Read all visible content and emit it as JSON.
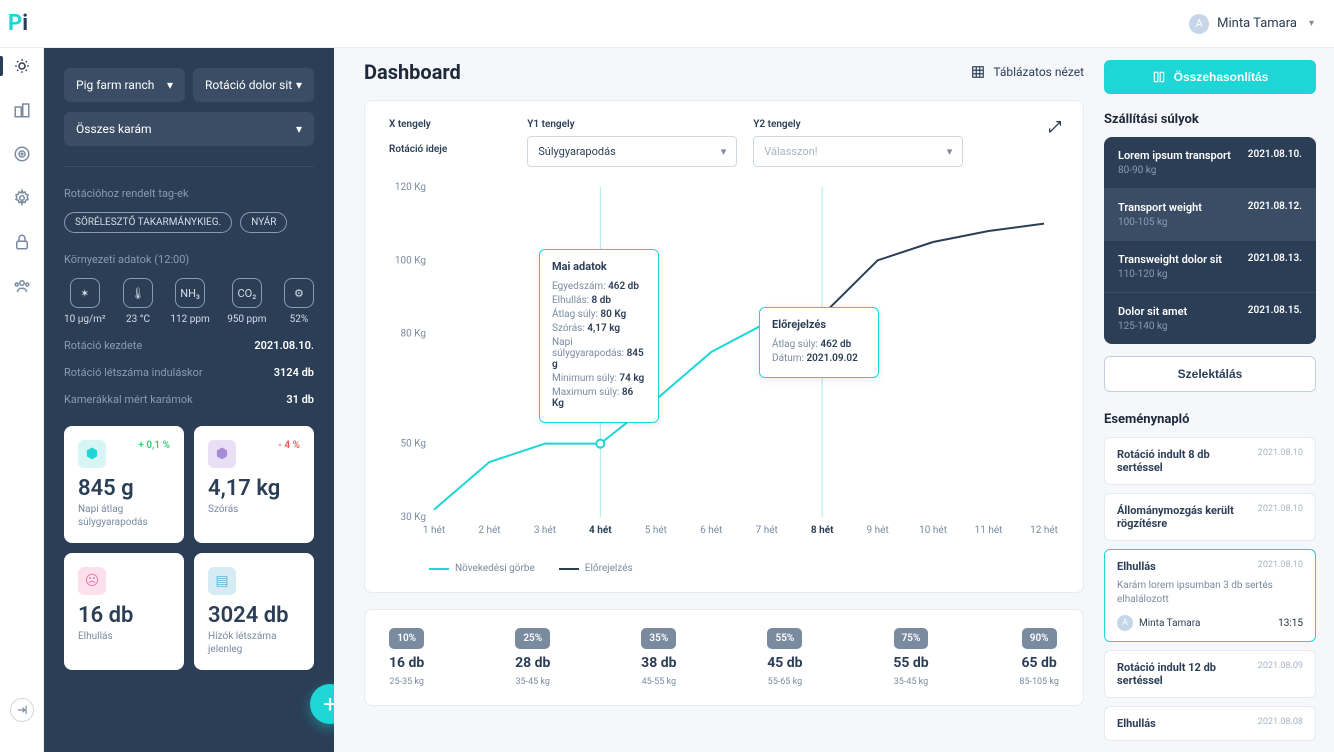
{
  "logo": {
    "p": "P",
    "i": "i"
  },
  "user": {
    "name": "Minta Tamara",
    "initial": "A"
  },
  "darkPanel": {
    "farmSelect": "Pig farm ranch",
    "rotationSelect": "Rotáció dolor sit",
    "penSelect": "Összes karám",
    "tagsLabel": "Rotációhoz rendelt tag-ek",
    "tags": [
      "SÖRÉLESZTŐ TAKARMÁNYKIEG.",
      "NYÁR"
    ],
    "envLabel": "Környezeti adatok (12:00)",
    "env": [
      {
        "icon": "✶",
        "val": "10 µg/m²"
      },
      {
        "icon": "🌡",
        "val": "23 °C"
      },
      {
        "icon": "NH₃",
        "val": "112 ppm"
      },
      {
        "icon": "CO₂",
        "val": "950 ppm"
      },
      {
        "icon": "⚙",
        "val": "52%"
      }
    ],
    "info": [
      {
        "k": "Rotáció kezdete",
        "v": "2021.08.10."
      },
      {
        "k": "Rotáció létszáma induláskor",
        "v": "3124 db"
      },
      {
        "k": "Kamerákkal mért karámok",
        "v": "31 db"
      }
    ],
    "stats": [
      {
        "icon": "⬢",
        "iconCls": "ic-teal",
        "delta": "+ 0,1 %",
        "deltaCls": "pos",
        "val": "845 g",
        "lab": "Napi átlag súlygyarapodás"
      },
      {
        "icon": "⬢",
        "iconCls": "ic-purple",
        "delta": "- 4 %",
        "deltaCls": "neg",
        "val": "4,17 kg",
        "lab": "Szórás"
      },
      {
        "icon": "☹",
        "iconCls": "ic-pink",
        "delta": "",
        "deltaCls": "",
        "val": "16 db",
        "lab": "Elhullás"
      },
      {
        "icon": "▤",
        "iconCls": "ic-blue",
        "delta": "",
        "deltaCls": "",
        "val": "3024 db",
        "lab": "Hízók létszáma jelenleg"
      }
    ]
  },
  "main": {
    "title": "Dashboard",
    "viewLink": "Táblázatos nézet",
    "xAxisLabel": "X tengely",
    "xAxisValue": "Rotáció ideje",
    "y1Label": "Y1 tengely",
    "y1Value": "Súlygyarapodás",
    "y2Label": "Y2 tengely",
    "y2Placeholder": "Válasszon!",
    "tooltip1": {
      "title": "Mai adatok",
      "rows": [
        {
          "k": "Egyedszám:",
          "v": "462 db"
        },
        {
          "k": "Elhullás:",
          "v": "8 db"
        },
        {
          "k": "Átlag súly:",
          "v": "80 Kg"
        },
        {
          "k": "Szórás:",
          "v": "4,17 kg"
        },
        {
          "k": "Napi súlygyarapodás:",
          "v": "845 g"
        },
        {
          "k": "Minimum súly:",
          "v": "74 kg"
        },
        {
          "k": "Maximum súly:",
          "v": "86 Kg"
        }
      ]
    },
    "tooltip2": {
      "title": "Előrejelzés",
      "rows": [
        {
          "k": "Átlag súly:",
          "v": "462 db"
        },
        {
          "k": "Dátum:",
          "v": "2021.09.02"
        }
      ]
    },
    "legend": [
      {
        "color": "#1ed6d6",
        "label": "Növekedési görbe"
      },
      {
        "color": "#2b3e56",
        "label": "Előrejelzés"
      }
    ],
    "buckets": [
      {
        "pct": "10%",
        "cnt": "16 db",
        "rng": "25-35 kg"
      },
      {
        "pct": "25%",
        "cnt": "28 db",
        "rng": "35-45 kg"
      },
      {
        "pct": "35%",
        "cnt": "38 db",
        "rng": "45-55 kg"
      },
      {
        "pct": "55%",
        "cnt": "45 db",
        "rng": "55-65 kg"
      },
      {
        "pct": "75%",
        "cnt": "55 db",
        "rng": "35-45 kg"
      },
      {
        "pct": "90%",
        "cnt": "65 db",
        "rng": "85-105 kg"
      }
    ]
  },
  "chart_data": {
    "type": "line",
    "xlabel": "hét",
    "ylabel": "Kg",
    "ylim": [
      30,
      120
    ],
    "categories": [
      "1 hét",
      "2 hét",
      "3 hét",
      "4 hét",
      "5 hét",
      "6 hét",
      "7 hét",
      "8 hét",
      "9 hét",
      "10 hét",
      "11 hét",
      "12 hét"
    ],
    "series": [
      {
        "name": "Növekedési görbe",
        "color": "#1ed6d6",
        "values": [
          32,
          45,
          50,
          50,
          62,
          75,
          83,
          null,
          null,
          null,
          null,
          null
        ]
      },
      {
        "name": "Előrejelzés",
        "color": "#2b3e56",
        "values": [
          null,
          null,
          null,
          null,
          null,
          null,
          83,
          85,
          100,
          105,
          108,
          110
        ]
      }
    ],
    "highlight_x": [
      "4 hét",
      "8 hét"
    ]
  },
  "right": {
    "compare": "Összehasonlítás",
    "shipTitle": "Szállítási súlyok",
    "shipments": [
      {
        "t": "Lorem ipsum transport",
        "w": "80-90 kg",
        "d": "2021.08.10."
      },
      {
        "t": "Transport weight",
        "w": "100-105 kg",
        "d": "2021.08.12.",
        "sel": true
      },
      {
        "t": "Transweight dolor sit",
        "w": "110-120 kg",
        "d": "2021.08.13."
      },
      {
        "t": "Dolor sit amet",
        "w": "125-140 kg",
        "d": "2021.08.15."
      }
    ],
    "selectBtn": "Szelektálás",
    "eventsTitle": "Eseménynapló",
    "events": [
      {
        "t": "Rotáció indult 8 db sertéssel",
        "d": "2021.08.10"
      },
      {
        "t": "Állománymozgás került rögzítésre",
        "d": "2021.08.10"
      },
      {
        "t": "Elhullás",
        "d": "2021.08.10",
        "desc": "Karám lorem ipsumban 3 db sertés elhalálozott",
        "user": "Minta Tamara",
        "time": "13:15",
        "active": true
      },
      {
        "t": "Rotáció indult 12 db sertéssel",
        "d": "2021.08.09"
      },
      {
        "t": "Elhullás",
        "d": "2021.08.08"
      }
    ]
  }
}
